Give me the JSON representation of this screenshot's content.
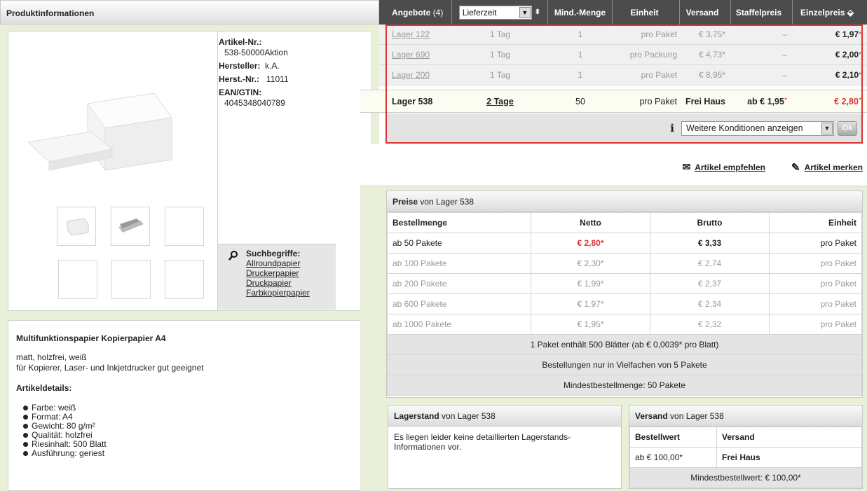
{
  "left": {
    "title": "Produktinformationen",
    "info": {
      "artnr_label": "Artikel-Nr.:",
      "artnr_value": "538-50000Aktion",
      "hersteller_label": "Hersteller:",
      "hersteller_value": "k.A.",
      "herstnr_label": "Herst.-Nr.:",
      "herstnr_value": "11011",
      "ean_label": "EAN/GTIN:",
      "ean_value": "4045348040789"
    },
    "such_title": "Suchbegriffe:",
    "such_links": [
      "Allroundpapier",
      "Druckerpapier",
      "Druckpapier",
      "Farbkopierpapier"
    ],
    "desc_title": "Multifunktionspapier Kopierpapier A4",
    "desc_line1": "matt, holzfrei, weiß",
    "desc_line2": "für Kopierer, Laser- und Inkjetdrucker gut geeignet",
    "details_title": "Artikeldetails:",
    "details": [
      "Farbe: weiß",
      "Format: A4",
      "Gewicht: 80 g/m²",
      "Qualität: holzfrei",
      "Riesinhalt: 500 Blatt",
      "Ausführung: geriest"
    ]
  },
  "offers": {
    "head": {
      "angebote": "Angebote",
      "count": "(4)",
      "select_value": "Lieferzeit",
      "mind": "Mind.-Menge",
      "einheit": "Einheit",
      "versand": "Versand",
      "staffel": "Staffelpreis",
      "einzel": "Einzelpreis"
    },
    "rows": [
      {
        "lager": "Lager 122",
        "zeit": "1 Tag",
        "menge": "1",
        "einheit": "pro Paket",
        "versand": "€ 3,75*",
        "staffel": "–",
        "preis": "€ 1,97",
        "star": "*"
      },
      {
        "lager": "Lager 690",
        "zeit": "1 Tag",
        "menge": "1",
        "einheit": "pro Packung",
        "versand": "€ 4,73*",
        "staffel": "–",
        "preis": "€ 2,00",
        "star": "*"
      },
      {
        "lager": "Lager 200",
        "zeit": "1 Tag",
        "menge": "1",
        "einheit": "pro Paket",
        "versand": "€ 8,95*",
        "staffel": "–",
        "preis": "€ 2,10",
        "star": "*"
      }
    ],
    "selected": {
      "lager": "Lager 538",
      "zeit": "2 Tage",
      "menge": "50",
      "einheit": "pro Paket",
      "versand": "Frei Haus",
      "staffel": "ab € 1,95",
      "star": "*",
      "preis": "€ 2,80"
    },
    "cond_select": "Weitere Konditionen anzeigen",
    "ok": "Ok",
    "empfehlen": "Artikel empfehlen",
    "merken": "Artikel merken"
  },
  "prices": {
    "title_bold": "Preise",
    "title_rest": "von Lager 538",
    "headers": [
      "Bestellmenge",
      "Netto",
      "Brutto",
      "Einheit"
    ],
    "rows": [
      [
        "ab 50 Pakete",
        "€ 2,80*",
        "€ 3,33",
        "pro Paket"
      ],
      [
        "ab 100 Pakete",
        "€ 2,30*",
        "€ 2,74",
        "pro Paket"
      ],
      [
        "ab 200 Pakete",
        "€ 1,99*",
        "€ 2,37",
        "pro Paket"
      ],
      [
        "ab 600 Pakete",
        "€ 1,97*",
        "€ 2,34",
        "pro Paket"
      ],
      [
        "ab 1000 Pakete",
        "€ 1,95*",
        "€ 2,32",
        "pro Paket"
      ]
    ],
    "notes": [
      "1 Paket enthält 500 Blätter (ab € 0,0039* pro Blatt)",
      "Bestellungen nur in Vielfachen von 5 Pakete",
      "Mindestbestellmenge: 50 Pakete"
    ]
  },
  "lager": {
    "title_bold": "Lagerstand",
    "title_rest": "von Lager 538",
    "text": "Es liegen leider keine detaillierten Lagerstands-Informationen vor."
  },
  "versand": {
    "title_bold": "Versand",
    "title_rest": "von Lager 538",
    "h1": "Bestellwert",
    "h2": "Versand",
    "r1": "ab € 100,00*",
    "r2": "Frei Haus",
    "mindest": "Mindestbestellwert: € 100,00*"
  }
}
